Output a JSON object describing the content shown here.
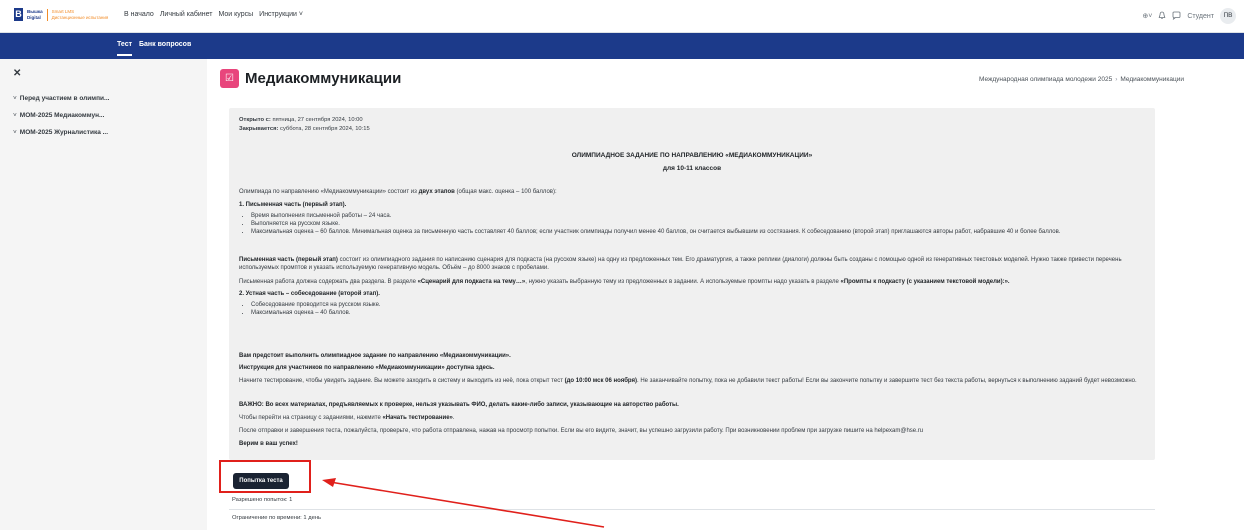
{
  "header": {
    "logo_mark": "В",
    "logo_line1": "Вышка",
    "logo_line2": "Digital",
    "logo_sub1": "Smart LMS",
    "logo_sub2": "Дистанционные испытания",
    "nav": [
      "В начало",
      "Личный кабинет",
      "Мои курсы",
      "Инструкции ˅"
    ],
    "user_name": "Студент",
    "user_initials": "ПВ",
    "globe_label": "⊕˅"
  },
  "secondary_nav": {
    "tabs": [
      "Тест",
      "Банк вопросов"
    ]
  },
  "drawer": {
    "close_glyph": "✕",
    "items": [
      "Перед участием в олимпи...",
      "МОМ-2025 Медиакоммун...",
      "МОМ-2025 Журналистика ..."
    ]
  },
  "page": {
    "title": "Медиакоммуникации",
    "breadcrumb": [
      "Международная олимпиада молодежи 2025",
      "Медиакоммуникации"
    ]
  },
  "dates": {
    "opened_label": "Открыто с:",
    "opened_value": "пятница, 27 сентября 2024, 10:00",
    "closes_label": "Закрывается:",
    "closes_value": "суббота, 28 сентября 2024, 10:15"
  },
  "task": {
    "heading": "ОЛИМПИАДНОЕ ЗАДАНИЕ ПО НАПРАВЛЕНИЮ «МЕДИАКОММУНИКАЦИИ»",
    "subheading": "для 10-11 классов",
    "intro_pre": "Олимпиада по направлению «Медиакоммуникации» состоит из ",
    "intro_bold": "двух этапов",
    "intro_post": " (общая макс. оценка – 100 баллов):",
    "part1_title": "1. Письменная часть (первый этап).",
    "part1_bullets": [
      "Время выполнения письменной работы – 24 часа.",
      "Выполняется на русском языке.",
      "Максимальная оценка – 60 баллов. Минимальная оценка за письменную часть составляет 40 баллов; если участник олимпиады получил менее 40 баллов, он считается выбывшим из состязания. К собеседованию (второй этап) приглашаются авторы работ, набравшие 40 и более баллов."
    ],
    "written_bold": "Письменная часть (первый этап)",
    "written_text": " состоит из олимпиадного задания по написанию сценария для подкаста (на русском языке) на одну из предложенных тем. Его драматургия, а также реплики (диалоги) должны быть созданы с помощью одной из генеративных текстовых моделей. Нужно также привести перечень используемых промптов и указать используемую генеративную модель. Объём – до 8000 знаков с пробелами.",
    "sections_pre": "Письменная работа должна содержать два раздела. В разделе ",
    "sections_b1": "«Сценарий для подкаста на тему…»",
    "sections_mid": ", нужно указать выбранную тему из предложенных в задании. А используемые промпты надо указать в разделе ",
    "sections_b2": "«Промпты к подкасту (с указанием текстовой модели):».",
    "part2_title": "2. Устная часть – собеседование (второй этап).",
    "part2_bullets": [
      "Собеседование проводится на русском языке.",
      "Максимальная оценка – 40 баллов."
    ],
    "line_start": "Вам предстоит выполнить олимпиадное задание по направлению «Медиакоммуникации».",
    "instr_pre": "Инструкция для участников по направлению «Медиакоммуникации» доступна ",
    "instr_link": "здесь",
    "instr_post": ".",
    "begin_pre": "Начните тестирование, чтобы увидеть задание. Вы можете заходить в систему и выходить из неё, пока открыт тест ",
    "begin_bold": "(до 10:00 мск 06 ноября)",
    "begin_post": ". Не заканчивайте попытку, пока не добавили текст работы! Если вы закончите попытку и завершите тест без текста работы, вернуться к выполнению заданий будет невозможно.",
    "important": "ВАЖНО: Во всех материалах, предъявляемых к проверке, нельзя указывать ФИО, делать какие-либо записи, указывающие на авторство работы.",
    "goto_pre": "Чтобы перейти на страницу с заданиями, нажмите ",
    "goto_bold": "«Начать тестирование»",
    "goto_post": ".",
    "after_submit": "После отправки и завершения теста, пожалуйста, проверьте, что работа отправлена, нажав на просмотр попытки. Если вы его видите, значит, вы успешно загрузили работу. При возникновении проблем при загрузке пишите на helpexam@hse.ru",
    "good_luck": "Верим в ваш успех!"
  },
  "attempt": {
    "button_label": "Попытка теста",
    "allowed_attempts": "Разрешено попыток: 1",
    "time_limit": "Ограничение по времени: 1 день"
  },
  "colors": {
    "brand_blue": "#1c3a8a",
    "accent_pink": "#e8457c",
    "annotation_red": "#e0201b",
    "button_dark": "#1a2332"
  }
}
